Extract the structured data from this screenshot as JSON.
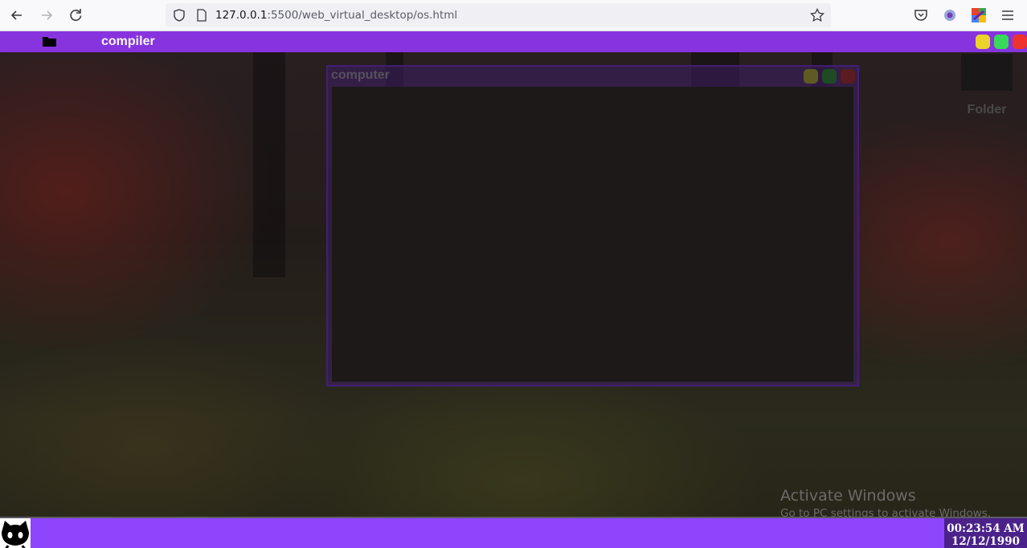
{
  "browser": {
    "url_host": "127.0.0.1",
    "url_path": ":5500/web_virtual_desktop/os.html"
  },
  "top_bar": {
    "app_title": "compiler"
  },
  "desktop": {
    "folder_label": "Folder"
  },
  "window": {
    "title": "computer"
  },
  "watermark": {
    "title": "Activate Windows",
    "subtitle": "Go to PC settings to activate Windows."
  },
  "taskbar": {
    "time": "00:23:54 AM",
    "date": "12/12/1990"
  },
  "colors": {
    "accent": "#8a35e6",
    "taskbar": "#8f45fb",
    "clock_bg": "#4a2289",
    "minimize": "#f2d92c",
    "maximize": "#39e05c",
    "close": "#f5332e"
  }
}
